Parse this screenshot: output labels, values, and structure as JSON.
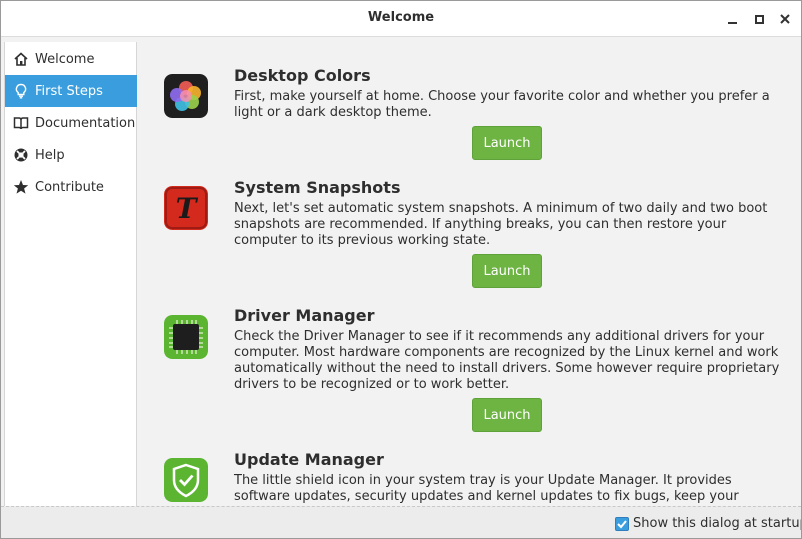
{
  "window": {
    "title": "Welcome"
  },
  "sidebar": {
    "items": [
      {
        "label": "Welcome",
        "icon": "home-icon",
        "active": false
      },
      {
        "label": "First Steps",
        "icon": "lightbulb-icon",
        "active": true
      },
      {
        "label": "Documentation",
        "icon": "book-icon",
        "active": false
      },
      {
        "label": "Help",
        "icon": "lifebuoy-icon",
        "active": false
      },
      {
        "label": "Contribute",
        "icon": "star-icon",
        "active": false
      }
    ]
  },
  "steps": [
    {
      "title": "Desktop Colors",
      "icon": "color-flower-icon",
      "description": "First, make yourself at home. Choose your favorite color and whether you prefer a light or a dark desktop theme.",
      "button": "Launch"
    },
    {
      "title": "System Snapshots",
      "icon": "timeshift-icon",
      "description": "Next, let's set automatic system snapshots. A minimum of two daily and two boot snapshots are recommended. If anything breaks, you can then restore your computer to its previous working state.",
      "button": "Launch"
    },
    {
      "title": "Driver Manager",
      "icon": "chip-icon",
      "description": "Check the Driver Manager to see if it recommends any additional drivers for your computer. Most hardware components are recognized by the Linux kernel and work automatically without the need to install drivers. Some however require proprietary drivers to be recognized or to work better.",
      "button": "Launch"
    },
    {
      "title": "Update Manager",
      "icon": "shield-icon",
      "description": "The little shield icon in your system tray is your Update Manager. It provides software updates, security updates and kernel updates to fix bugs, keep your computer safe and"
    }
  ],
  "footer": {
    "startup_label": "Show this dialog at startup",
    "startup_checked": true
  },
  "colors": {
    "accent": "#3a9ede",
    "launch": "#6db442"
  }
}
